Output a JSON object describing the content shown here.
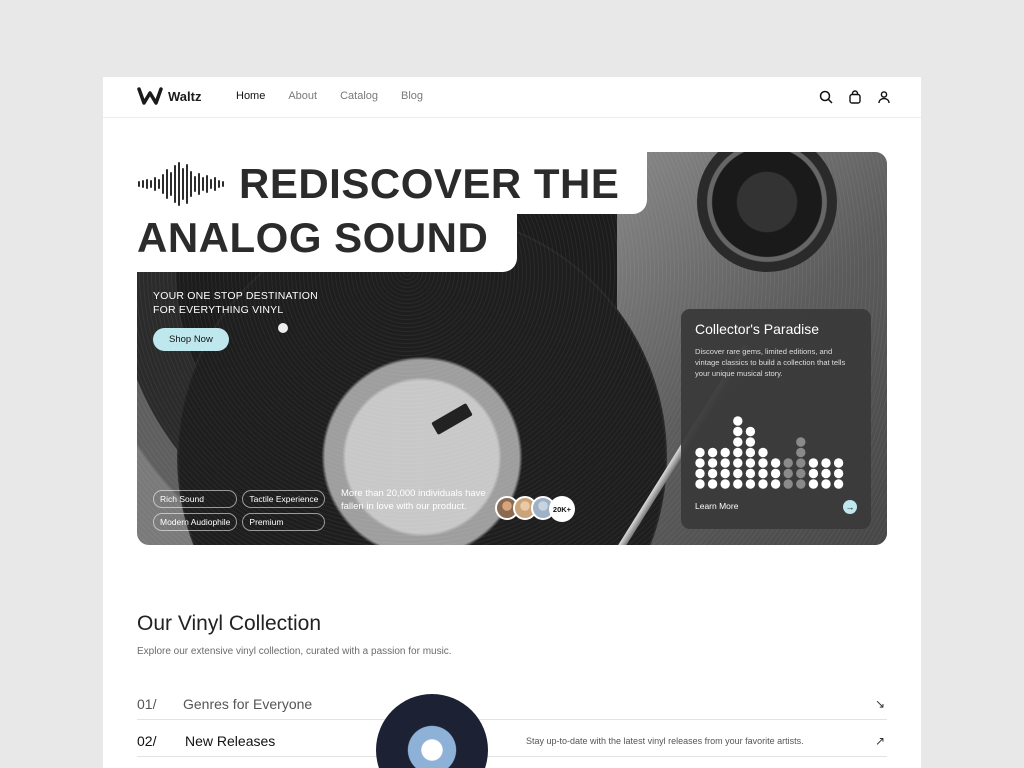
{
  "brand": {
    "name": "Waltz"
  },
  "nav": {
    "links": [
      "Home",
      "About",
      "Catalog",
      "Blog"
    ],
    "active": "Home",
    "icons": [
      "search-icon",
      "bag-icon",
      "user-icon"
    ]
  },
  "hero": {
    "title_line1": "REDISCOVER THE",
    "title_line2": "ANALOG SOUND",
    "tagline": "YOUR ONE STOP DESTINATION FOR EVERYTHING VINYL",
    "shop_button": "Shop Now",
    "tags": [
      "Rich Sound",
      "Tactile Experience",
      "Modern Audiophile",
      "Premium"
    ],
    "fans_text": "More than 20,000 individuals have fallen in love with our product.",
    "fans_count": "20K+",
    "accent_color": "#bfe8ee"
  },
  "card": {
    "title": "Collector's Paradise",
    "description": "Discover rare gems, limited editions, and vintage classics to build a collection that tells your unique musical story.",
    "link": "Learn More",
    "equalizer_columns": [
      4,
      4,
      4,
      7,
      6,
      4,
      3,
      3,
      5,
      3,
      3,
      3
    ],
    "equalizer_highlight_until": 7
  },
  "collection": {
    "title": "Our Vinyl Collection",
    "subtitle": "Explore our extensive vinyl collection, curated with a passion for music.",
    "rows": [
      {
        "num": "01/",
        "label": "Genres for Everyone",
        "desc": ""
      },
      {
        "num": "02/",
        "label": "New Releases",
        "desc": "Stay up-to-date with the latest vinyl releases from your favorite artists."
      }
    ]
  }
}
